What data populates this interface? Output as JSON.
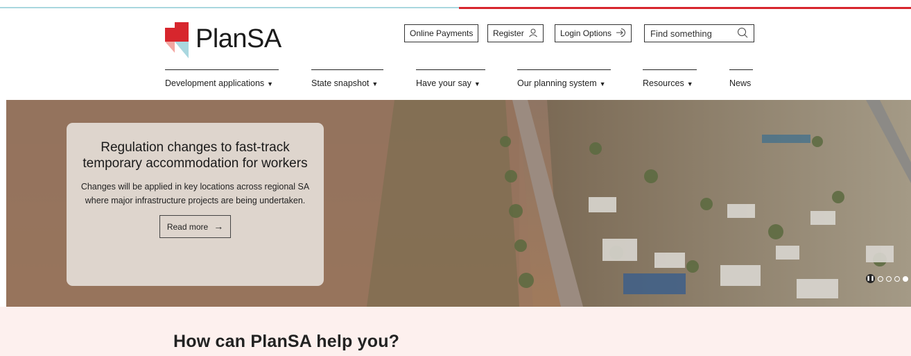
{
  "brand": {
    "name": "PlanSA",
    "colors": {
      "red": "#d7262d",
      "teal": "#a9d7df",
      "pink": "#f3a7a2"
    }
  },
  "utility": {
    "online_payments": "Online Payments",
    "register": "Register",
    "login": "Login Options",
    "search_placeholder": "Find something",
    "register_icon": "user-icon",
    "login_icon": "login-arrow-icon",
    "search_icon": "search-icon"
  },
  "nav": {
    "items": [
      {
        "label": "Development applications",
        "has_dropdown": true
      },
      {
        "label": "State snapshot",
        "has_dropdown": true
      },
      {
        "label": "Have your say",
        "has_dropdown": true
      },
      {
        "label": "Our planning system",
        "has_dropdown": true
      },
      {
        "label": "Resources",
        "has_dropdown": true
      },
      {
        "label": "News",
        "has_dropdown": false
      }
    ],
    "caret": "▼"
  },
  "hero": {
    "title": "Regulation changes to fast-track temporary accommodation for workers",
    "description": "Changes will be applied in key locations across regional SA where major infrastructure projects are being undertaken.",
    "cta": "Read more",
    "cta_icon": "→",
    "slides": {
      "current": 4,
      "total": 4
    }
  },
  "help": {
    "heading": "How can PlanSA help you?"
  }
}
